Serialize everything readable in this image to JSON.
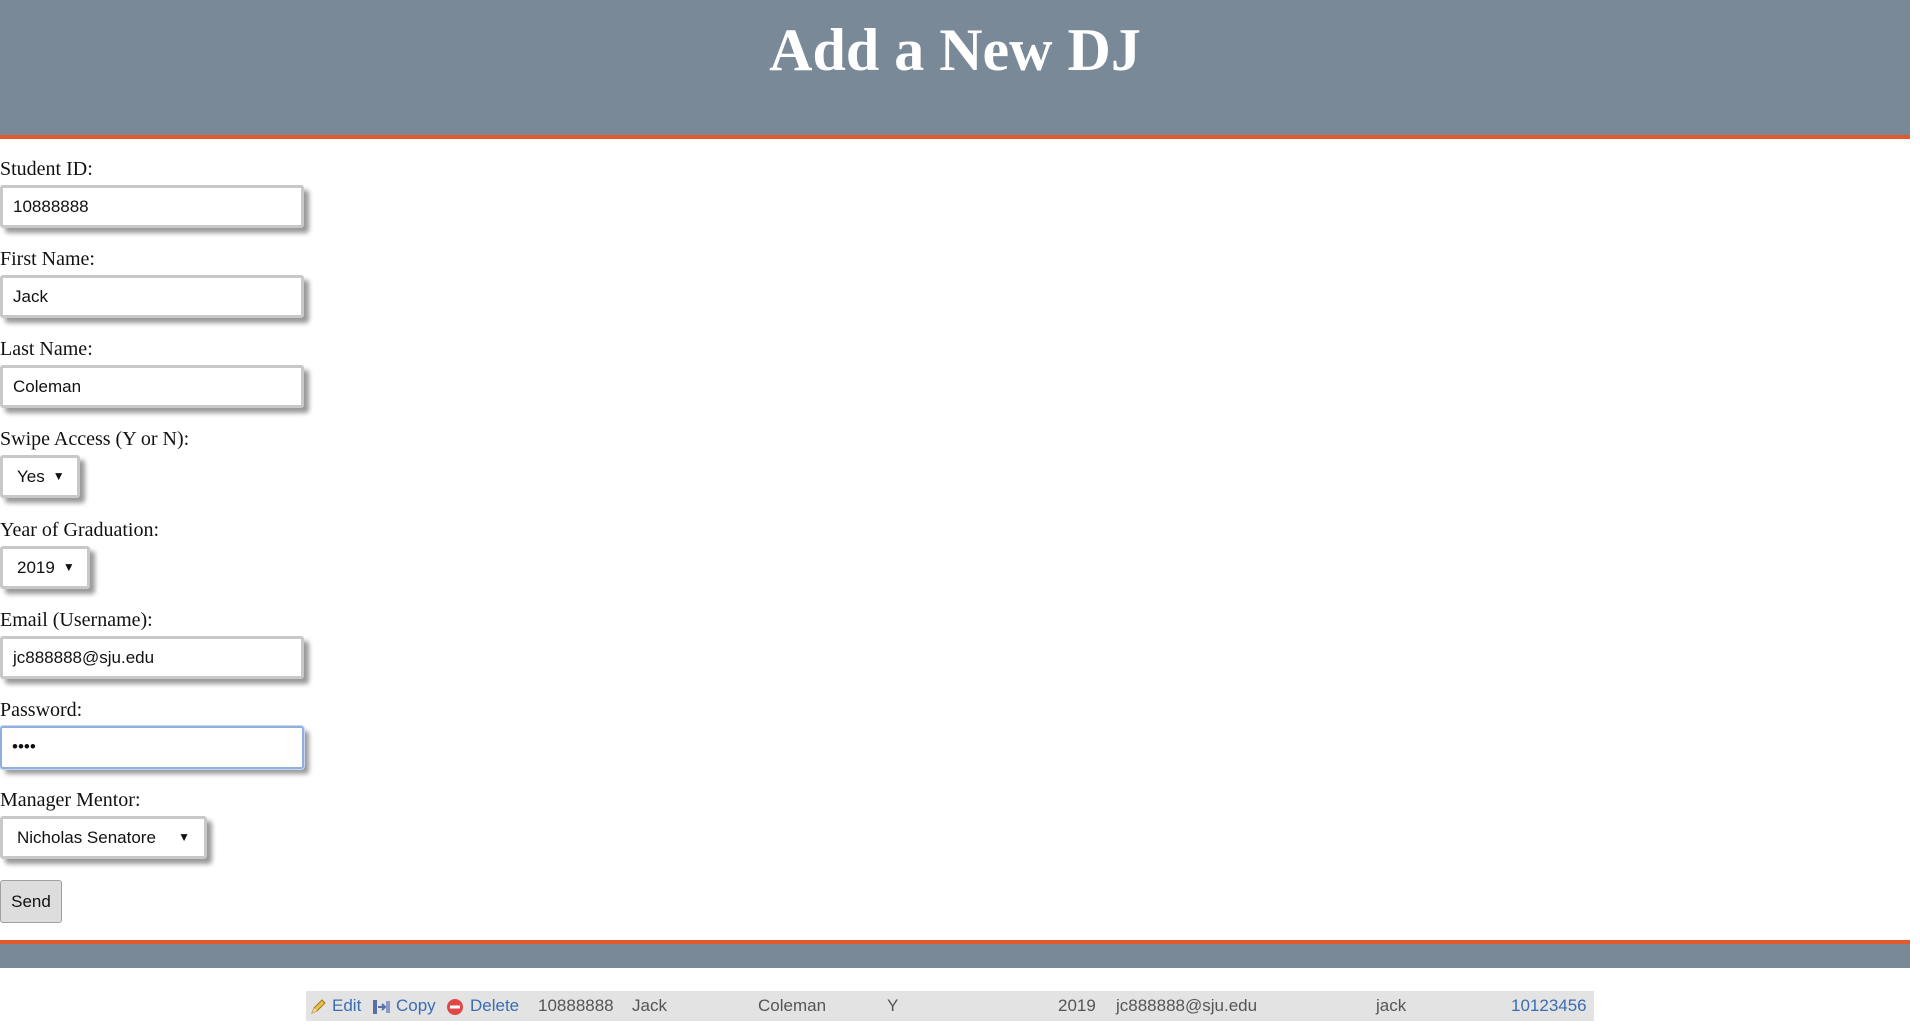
{
  "header": {
    "title": "Add a New DJ"
  },
  "form": {
    "student_id": {
      "label": "Student ID:",
      "value": "10888888"
    },
    "first_name": {
      "label": "First Name:",
      "value": "Jack"
    },
    "last_name": {
      "label": "Last Name:",
      "value": "Coleman"
    },
    "swipe_access": {
      "label": "Swipe Access (Y or N):",
      "value": "Yes"
    },
    "graduation_year": {
      "label": "Year of Graduation:",
      "value": "2019"
    },
    "email": {
      "label": "Email (Username):",
      "value": "jc888888@sju.edu"
    },
    "password": {
      "label": "Password:",
      "value": "••••"
    },
    "manager_mentor": {
      "label": "Manager Mentor:",
      "value": "Nicholas Senatore"
    },
    "send_label": "Send"
  },
  "record": {
    "actions": {
      "edit": "Edit",
      "copy": "Copy",
      "delete": "Delete"
    },
    "icons": {
      "edit": "pencil-icon",
      "copy": "copy-icon",
      "delete": "delete-icon"
    },
    "student_id": "10888888",
    "first_name": "Jack",
    "last_name": "Coleman",
    "swipe_access": "Y",
    "graduation_year": "2019",
    "email": "jc888888@sju.edu",
    "username": "jack",
    "mentor_id": "10123456"
  },
  "colors": {
    "header_bg": "#7a8998",
    "accent": "#e05a2b",
    "link": "#3a6db3"
  }
}
